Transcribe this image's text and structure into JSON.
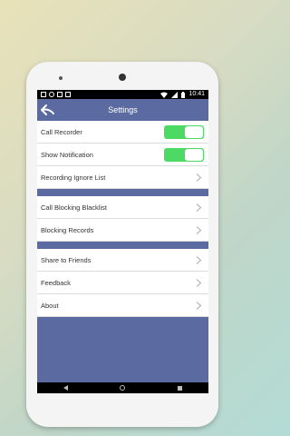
{
  "statusbar": {
    "time": "10:41"
  },
  "appbar": {
    "title": "Settings",
    "back_icon": "arrow-back-icon"
  },
  "settings": {
    "call_recorder": {
      "label": "Call Recorder",
      "enabled": true
    },
    "show_notification": {
      "label": "Show Notification",
      "enabled": true
    },
    "recording_ignore_list": {
      "label": "Recording Ignore List"
    },
    "call_blocking_blacklist": {
      "label": "Call Blocking Blacklist"
    },
    "blocking_records": {
      "label": "Blocking Records"
    },
    "share_to_friends": {
      "label": "Share to Friends"
    },
    "feedback": {
      "label": "Feedback"
    },
    "about": {
      "label": "About"
    }
  },
  "colors": {
    "primary": "#5b6aa1",
    "toggle_on": "#4cd964"
  }
}
